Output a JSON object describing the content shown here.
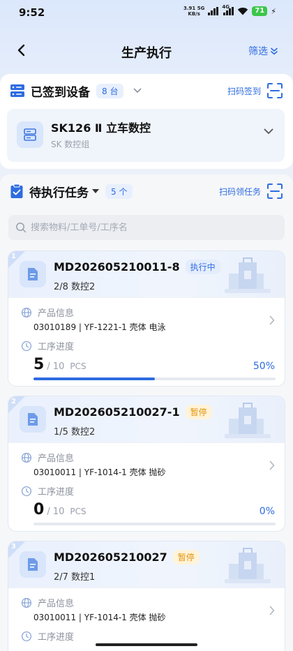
{
  "status_bar": {
    "time": "9:52",
    "net_speed_top": "3.91",
    "net_speed_bottom": "KB/s",
    "net_5g": "5G",
    "net_4g": "4G",
    "battery": "71"
  },
  "header": {
    "title": "生产执行",
    "filter_label": "筛选"
  },
  "devices": {
    "title": "已签到设备",
    "count": "8 台",
    "scan_label": "扫码签到",
    "item": {
      "name": "SK126 Ⅱ 立车数控",
      "group": "SK 数控组"
    }
  },
  "tasks": {
    "title": "待执行任务",
    "count": "5 个",
    "scan_label": "扫码领任务",
    "search_placeholder": "搜索物料/工单号/工序名",
    "product_label": "产品信息",
    "progress_label": "工序进度",
    "items": [
      {
        "index": "1",
        "code": "MD202605210011-8",
        "status": "执行中",
        "step": "2/8 数控2",
        "product": "03010189 | YF-1221-1 壳体 电泳",
        "done": "5",
        "total": "/ 10",
        "unit": "PCS",
        "percent": "50%",
        "progress": 0.5
      },
      {
        "index": "2",
        "code": "MD202605210027-1",
        "status": "暂停",
        "step": "1/5 数控2",
        "product": "03010011 | YF-1014-1 壳体 抛砂",
        "done": "0",
        "total": "/ 10",
        "unit": "PCS",
        "percent": "0%",
        "progress": 0
      },
      {
        "index": "3",
        "code": "MD202605210027",
        "status": "暂停",
        "step": "2/7 数控1",
        "product": "03010011 | YF-1014-1 壳体 抛砂"
      }
    ]
  },
  "colors": {
    "accent": "#2e6ce0",
    "paused": "#e3950e"
  }
}
